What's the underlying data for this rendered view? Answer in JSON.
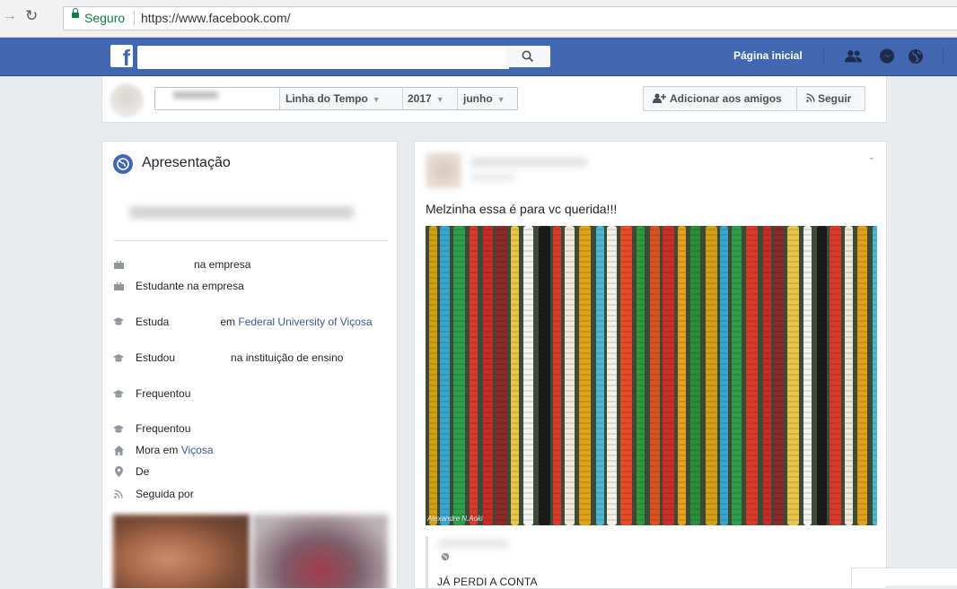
{
  "browser": {
    "secure_label": "Seguro",
    "url": "https://www.facebook.com/"
  },
  "topbar": {
    "logo": "f",
    "search_placeholder": "",
    "home_label": "Página inicial",
    "icons": [
      "friends-icon",
      "messenger-icon",
      "globe-icon"
    ]
  },
  "timeline_nav": {
    "timeline_label": "Linha do Tempo",
    "year": "2017",
    "month": "junho",
    "add_friend_label": "Adicionar aos amigos",
    "follow_label": "Seguir"
  },
  "intro": {
    "title": "Apresentação",
    "rows": [
      {
        "icon": "briefcase-icon",
        "text": "na empresa"
      },
      {
        "icon": "briefcase-icon",
        "text": "Estudante na empresa"
      },
      {
        "icon": "graduation-cap-icon",
        "prefix": "Estuda",
        "middle": "em",
        "link": "Federal University of Viçosa"
      },
      {
        "icon": "graduation-cap-icon",
        "prefix": "Estudou",
        "middle": "na instituição de ensino"
      },
      {
        "icon": "graduation-cap-icon",
        "prefix": "Frequentou"
      },
      {
        "icon": "graduation-cap-icon",
        "prefix": "Frequentou"
      },
      {
        "icon": "home-icon",
        "prefix": "Mora em",
        "link": "Viçosa"
      },
      {
        "icon": "pin-icon",
        "prefix": "De"
      },
      {
        "icon": "rss-icon",
        "prefix": "Seguida por"
      }
    ]
  },
  "post": {
    "text": "Melzinha essa é para vc querida!!!",
    "image_watermark": "Alexandre N.Aoki",
    "shared_title": "JÁ PERDI A CONTA"
  }
}
